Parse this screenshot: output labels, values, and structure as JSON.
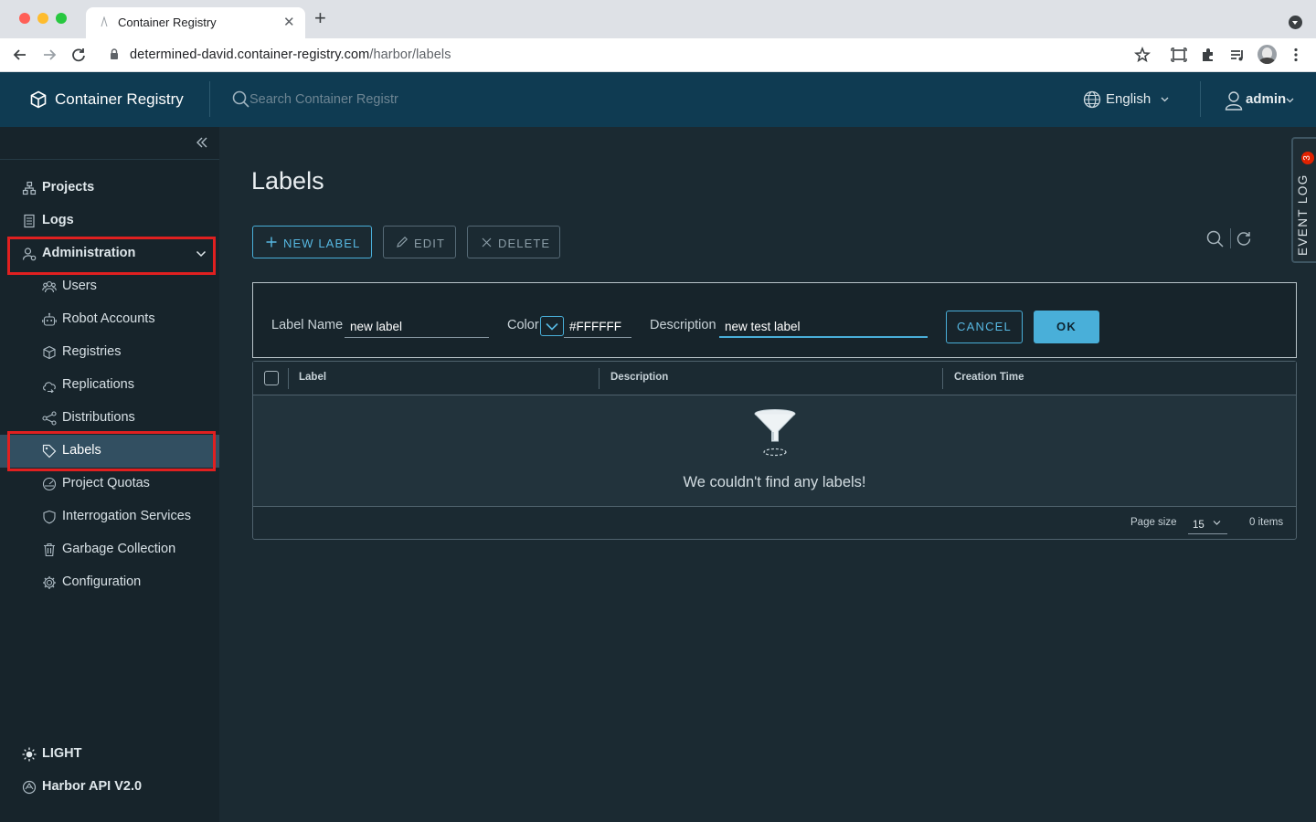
{
  "browser": {
    "tab_title": "Container Registry",
    "url_host": "determined-david.container-registry.com",
    "url_path": "/harbor/labels"
  },
  "header": {
    "brand": "Container Registry",
    "search_placeholder": "Search Container Registr",
    "language": "English",
    "user": "admin"
  },
  "sidebar": {
    "items": [
      {
        "label": "Projects",
        "icon": "projects-icon"
      },
      {
        "label": "Logs",
        "icon": "logs-icon"
      },
      {
        "label": "Administration",
        "icon": "administration-icon"
      }
    ],
    "admin_items": [
      {
        "label": "Users",
        "icon": "users-icon"
      },
      {
        "label": "Robot Accounts",
        "icon": "robot-icon"
      },
      {
        "label": "Registries",
        "icon": "registries-icon"
      },
      {
        "label": "Replications",
        "icon": "replications-icon"
      },
      {
        "label": "Distributions",
        "icon": "distributions-icon"
      },
      {
        "label": "Labels",
        "icon": "tag-icon"
      },
      {
        "label": "Project Quotas",
        "icon": "quota-icon"
      },
      {
        "label": "Interrogation Services",
        "icon": "shield-icon"
      },
      {
        "label": "Garbage Collection",
        "icon": "trash-icon"
      },
      {
        "label": "Configuration",
        "icon": "gear-icon"
      }
    ],
    "theme": "LIGHT",
    "api": "Harbor API V2.0"
  },
  "main": {
    "title": "Labels",
    "buttons": {
      "new_label": "NEW LABEL",
      "edit": "EDIT",
      "delete": "DELETE"
    },
    "form": {
      "label_name_label": "Label Name",
      "label_name_value": "new label",
      "color_label": "Color",
      "color_value": "#FFFFFF",
      "description_label": "Description",
      "description_value": "new test label",
      "cancel": "CANCEL",
      "ok": "OK"
    },
    "grid": {
      "columns": [
        "Label",
        "Description",
        "Creation Time"
      ],
      "empty_message": "We couldn't find any labels!",
      "page_size_label": "Page size",
      "page_size": "15",
      "items_count": "0 items"
    },
    "event_log": {
      "label": "EVENT LOG",
      "badge": "3"
    }
  },
  "colors": {
    "header_bg": "#0f3b52",
    "sidebar_bg": "#17242b",
    "main_bg": "#1b2a32",
    "accent": "#49afd9",
    "highlight_box": "#e02020",
    "active_item": "#324f61"
  }
}
